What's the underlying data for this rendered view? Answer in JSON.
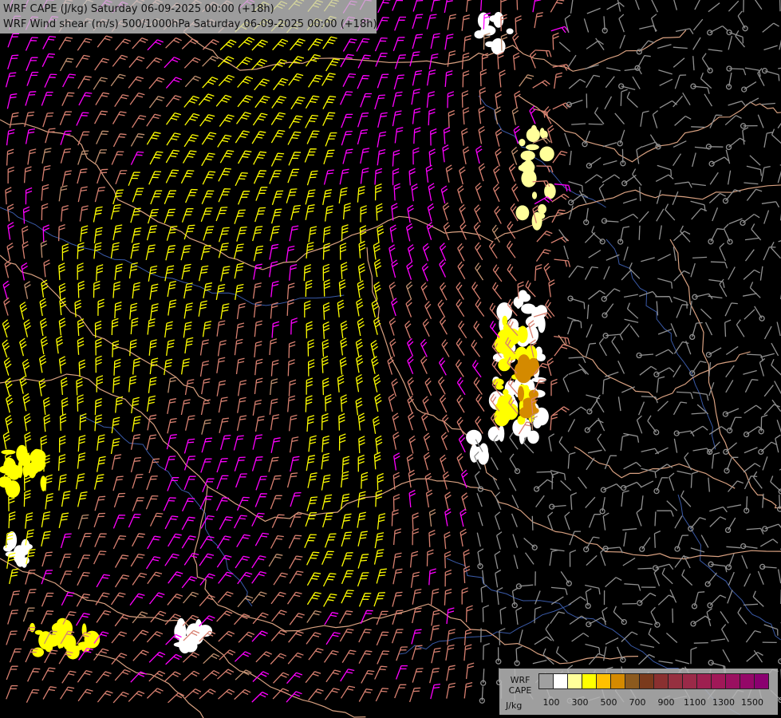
{
  "titles": {
    "line1": "WRF CAPE (J/kg) Saturday 06-09-2025 00:00 (+18h)",
    "line2": "WRF Wind shear (m/s) 500/1000hPa Saturday 06-09-2025 00:00 (+18h)"
  },
  "legend": {
    "title_line1": "WRF",
    "title_line2": "CAPE",
    "unit": "J/kg",
    "ticks": [
      "100",
      "300",
      "500",
      "700",
      "900",
      "1100",
      "1300",
      "1500"
    ],
    "colors": [
      "#a0a0a0",
      "#ffffff",
      "#ffff9a",
      "#ffff00",
      "#ffc000",
      "#d48a00",
      "#8c5a1e",
      "#7a3a1c",
      "#8a3030",
      "#963040",
      "#9a2a48",
      "#9e2050",
      "#a01858",
      "#9a1060",
      "#940868",
      "#8a0070"
    ]
  },
  "map_colors": {
    "background": "#000000",
    "borders": "#d8a080",
    "rivers": "#3a5aa8",
    "barb_colors": {
      "weak": "#909090",
      "moderate": "#d88070",
      "strong": "#ff00ff",
      "very_strong": "#ffff00",
      "light": "#c09070"
    }
  }
}
